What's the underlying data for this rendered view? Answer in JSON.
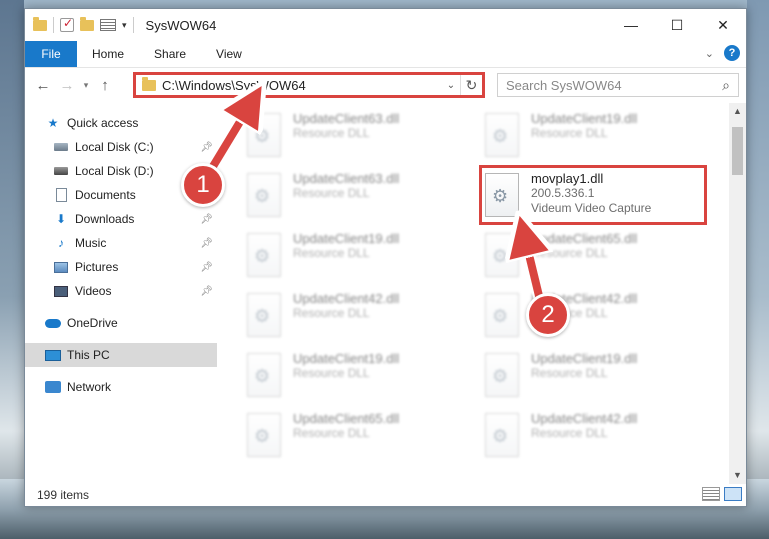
{
  "window": {
    "title": "SysWOW64"
  },
  "ribbon": {
    "tabs": [
      "File",
      "Home",
      "Share",
      "View"
    ],
    "help": "?"
  },
  "address": {
    "path": "C:\\Windows\\SysWOW64",
    "search_placeholder": "Search SysWOW64"
  },
  "nav": {
    "items": [
      {
        "label": "Quick access",
        "icon": "star-icon",
        "pinned": false
      },
      {
        "label": "Local Disk (C:)",
        "icon": "drive-icon",
        "pinned": true
      },
      {
        "label": "Local Disk (D:)",
        "icon": "drive-icon",
        "pinned": false
      },
      {
        "label": "Documents",
        "icon": "documents-icon",
        "pinned": true
      },
      {
        "label": "Downloads",
        "icon": "download-icon",
        "pinned": true
      },
      {
        "label": "Music",
        "icon": "music-icon",
        "pinned": true
      },
      {
        "label": "Pictures",
        "icon": "pictures-icon",
        "pinned": true
      },
      {
        "label": "Videos",
        "icon": "videos-icon",
        "pinned": true
      },
      {
        "label": "OneDrive",
        "icon": "cloud-icon",
        "pinned": false
      },
      {
        "label": "This PC",
        "icon": "pc-icon",
        "pinned": false
      },
      {
        "label": "Network",
        "icon": "network-icon",
        "pinned": false
      }
    ]
  },
  "files": [
    {
      "name": "UpdateClient63.dll",
      "type": "Resource DLL"
    },
    {
      "name": "UpdateClient19.dll",
      "type": "Resource DLL"
    },
    {
      "name": "UpdateClient63.dll",
      "type": "Resource DLL"
    },
    {
      "name": "movplay1.dll",
      "version": "200.5.336.1",
      "description": "Videum Video Capture"
    },
    {
      "name": "UpdateClient19.dll",
      "type": "Resource DLL"
    },
    {
      "name": "UpdateClient65.dll",
      "type": "Resource DLL"
    },
    {
      "name": "UpdateClient42.dll",
      "type": "Resource DLL"
    },
    {
      "name": "UpdateClient42.dll",
      "type": "Resource DLL"
    },
    {
      "name": "UpdateClient19.dll",
      "type": "Resource DLL"
    },
    {
      "name": "UpdateClient19.dll",
      "type": "Resource DLL"
    },
    {
      "name": "UpdateClient65.dll",
      "type": "Resource DLL"
    },
    {
      "name": "UpdateClient42.dll",
      "type": "Resource DLL"
    }
  ],
  "status": {
    "count": "199 items"
  },
  "annotations": {
    "step1": "1",
    "step2": "2",
    "color": "#d9443f"
  }
}
